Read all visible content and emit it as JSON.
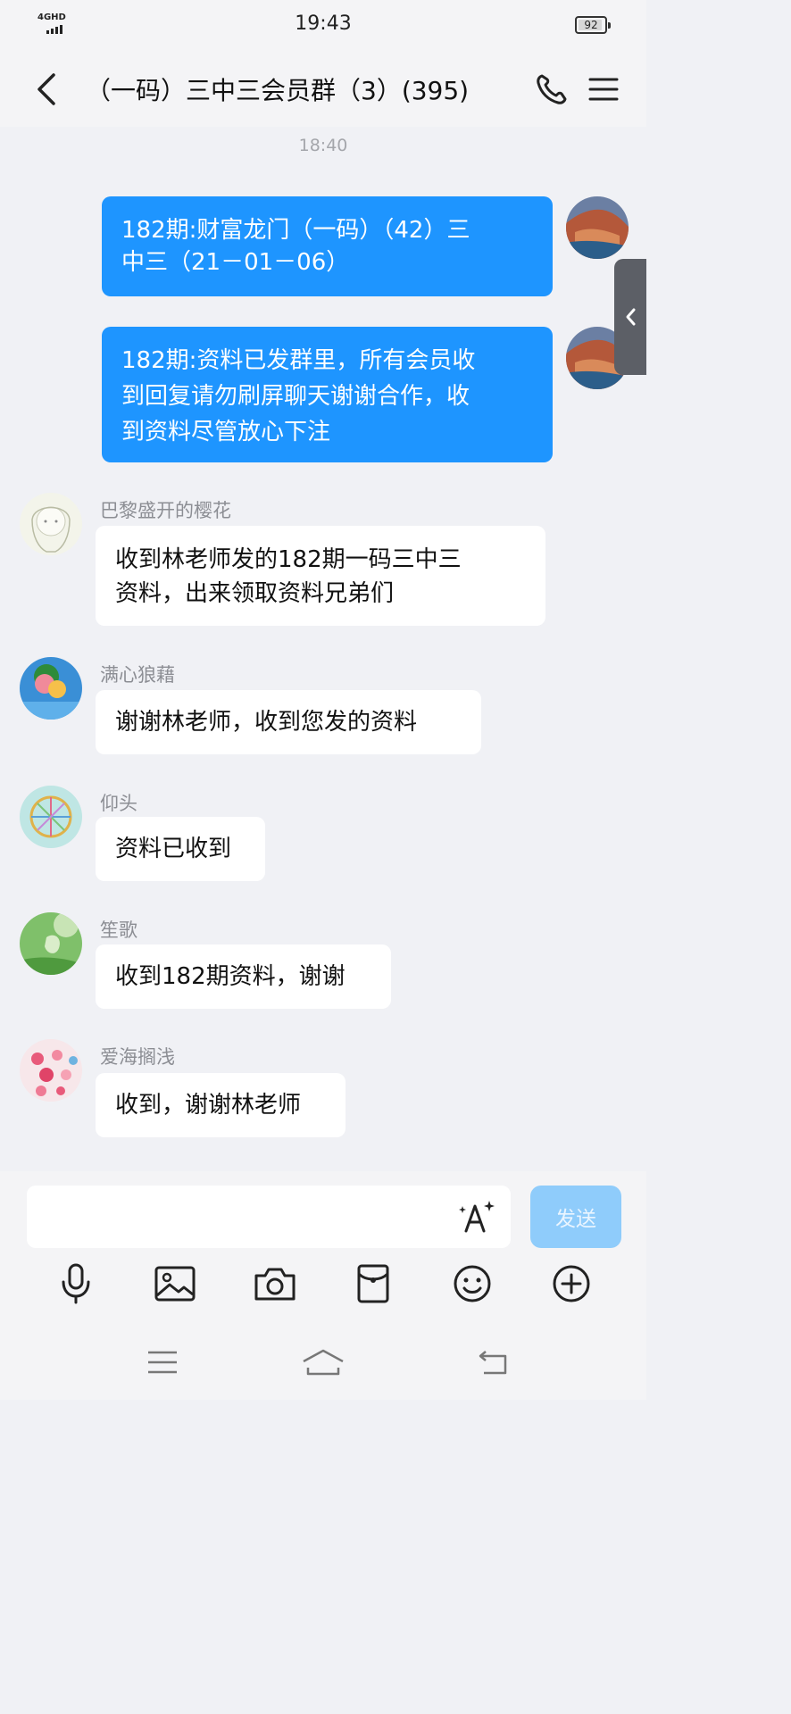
{
  "status_bar": {
    "time": "19:43",
    "network": "4GHD",
    "battery": "92",
    "battery_level": 0.92
  },
  "header": {
    "title": "（一码）三中三会员群（3）(395)"
  },
  "chat": {
    "timestamp": "18:40",
    "outgoing": [
      {
        "lines": [
          "182期:财富龙门（一码）（42）三",
          "中三（21－01－06）"
        ]
      },
      {
        "lines": [
          "182期:资料已发群里，所有会员收",
          "到回复请勿刷屏聊天谢谢合作，收",
          "到资料尽管放心下注"
        ]
      }
    ],
    "incoming": [
      {
        "sender": "巴黎盛开的樱花",
        "lines": [
          "收到林老师发的182期一码三中三",
          "资料，出来领取资料兄弟们"
        ]
      },
      {
        "sender": "满心狼藉",
        "lines": [
          "谢谢林老师，收到您发的资料"
        ]
      },
      {
        "sender": "仰头",
        "lines": [
          "资料已收到"
        ]
      },
      {
        "sender": "笙歌",
        "lines": [
          "收到182期资料，谢谢"
        ]
      },
      {
        "sender": "爱海搁浅",
        "lines": [
          "收到，谢谢林老师"
        ]
      }
    ]
  },
  "input": {
    "value": "",
    "send_label": "发送"
  },
  "toolbar": [
    "microphone-icon",
    "image-icon",
    "camera-icon",
    "red-packet-icon",
    "emoji-icon",
    "plus-icon"
  ],
  "nav": [
    "menu-icon",
    "home-icon",
    "back-icon"
  ],
  "colors": {
    "outgoing_bubble": "#1e95ff",
    "send_button": "#8fccfb",
    "background": "#f0f1f5"
  }
}
